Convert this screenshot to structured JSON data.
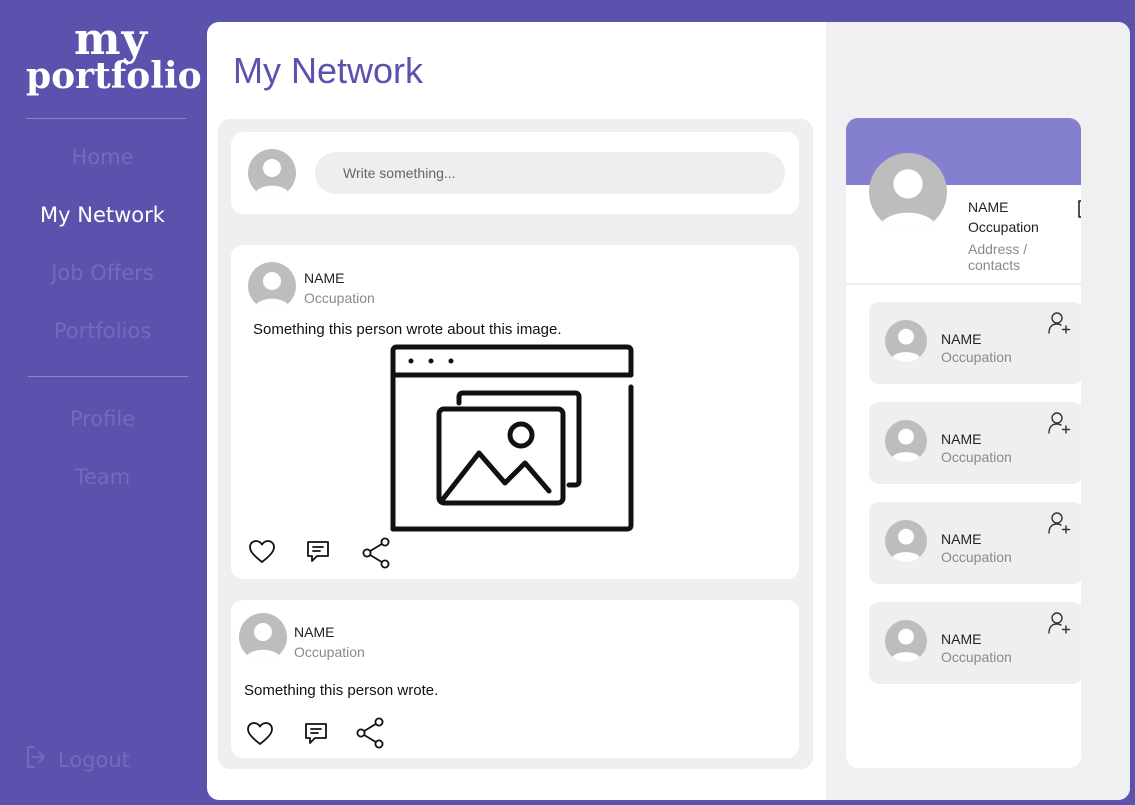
{
  "logo": {
    "line1": "my",
    "line2": "portfolio"
  },
  "nav": {
    "items": [
      {
        "label": "Home",
        "active": false
      },
      {
        "label": "My Network",
        "active": true
      },
      {
        "label": "Job Offers",
        "active": false
      },
      {
        "label": "Portfolios",
        "active": false
      },
      {
        "label": "Profile",
        "active": false
      },
      {
        "label": "Team",
        "active": false
      }
    ],
    "logout": "Logout"
  },
  "page": {
    "title": "My Network"
  },
  "compose": {
    "placeholder": "Write something..."
  },
  "posts": [
    {
      "name": "NAME",
      "occupation": "Occupation",
      "text": "Something this person wrote about this image.",
      "has_image": true
    },
    {
      "name": "NAME",
      "occupation": "Occupation",
      "text": "Something this person wrote.",
      "has_image": false
    }
  ],
  "profile": {
    "name": "NAME",
    "occupation": "Occupation",
    "address": "Address / contacts"
  },
  "suggestions": [
    {
      "name": "NAME",
      "occupation": "Occupation"
    },
    {
      "name": "NAME",
      "occupation": "Occupation"
    },
    {
      "name": "NAME",
      "occupation": "Occupation"
    },
    {
      "name": "NAME",
      "occupation": "Occupation"
    }
  ],
  "colors": {
    "brand": "#5a52ad",
    "accent_header": "#8480cf",
    "nav_inactive": "#716bbf",
    "avatar_gray": "#bdbdbd"
  },
  "icons": {
    "like": "heart-icon",
    "comment": "comment-icon",
    "share": "share-icon",
    "edit": "edit-icon",
    "add_friend": "add-user-icon",
    "logout": "logout-icon",
    "image_placeholder": "image-placeholder-icon"
  }
}
